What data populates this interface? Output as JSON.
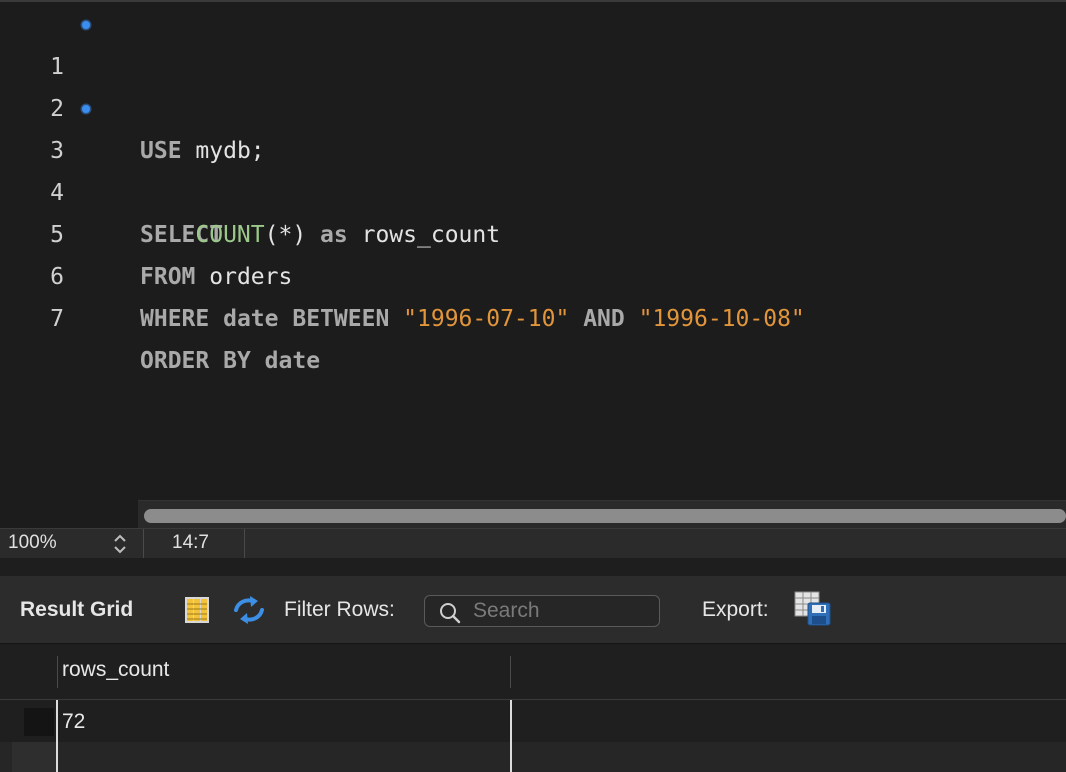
{
  "editor": {
    "lines": [
      {
        "num": "1",
        "marker": true
      },
      {
        "num": "2",
        "marker": false
      },
      {
        "num": "3",
        "marker": true
      },
      {
        "num": "4",
        "marker": false
      },
      {
        "num": "5",
        "marker": false
      },
      {
        "num": "6",
        "marker": false
      },
      {
        "num": "7",
        "marker": false
      }
    ],
    "tokens": {
      "l1_use": "USE",
      "l1_db": "mydb;",
      "l3_select": "SELECT",
      "l4_count": "COUNT",
      "l4_star": "(*)",
      "l4_as": "as",
      "l4_alias": "rows_count",
      "l5_from": "FROM",
      "l5_table": "orders",
      "l6_where": "WHERE",
      "l6_col": "date",
      "l6_between": "BETWEEN",
      "l6_start": "\"1996-07-10\"",
      "l6_and": "AND",
      "l6_end": "\"1996-10-08\"",
      "l7_order": "ORDER",
      "l7_by": "BY",
      "l7_col": "date"
    }
  },
  "status": {
    "zoom": "100%",
    "cursor": "14:7"
  },
  "toolbar": {
    "result_grid_label": "Result Grid",
    "filter_label": "Filter Rows:",
    "search_placeholder": "Search",
    "search_value": "",
    "export_label": "Export:"
  },
  "grid": {
    "columns": [
      "rows_count"
    ],
    "rows": [
      [
        "72"
      ]
    ]
  },
  "colors": {
    "keyword": "#a9a9a9",
    "function": "#9cc98a",
    "string": "#e2953a",
    "marker": "#3b8ef0",
    "refresh_icon": "#3d8fe6"
  }
}
